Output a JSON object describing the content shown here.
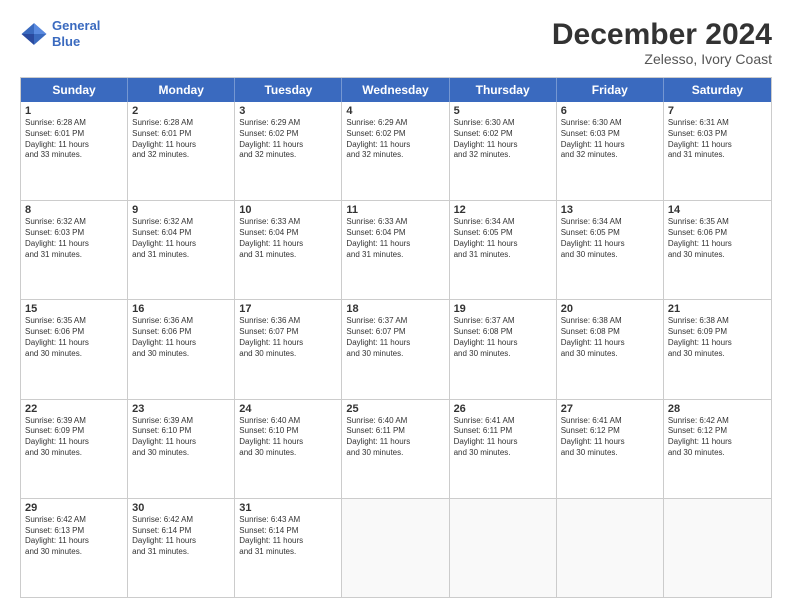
{
  "header": {
    "logo_line1": "General",
    "logo_line2": "Blue",
    "month_title": "December 2024",
    "location": "Zelesso, Ivory Coast"
  },
  "weekdays": [
    "Sunday",
    "Monday",
    "Tuesday",
    "Wednesday",
    "Thursday",
    "Friday",
    "Saturday"
  ],
  "rows": [
    [
      {
        "day": "1",
        "lines": [
          "Sunrise: 6:28 AM",
          "Sunset: 6:01 PM",
          "Daylight: 11 hours",
          "and 33 minutes."
        ]
      },
      {
        "day": "2",
        "lines": [
          "Sunrise: 6:28 AM",
          "Sunset: 6:01 PM",
          "Daylight: 11 hours",
          "and 32 minutes."
        ]
      },
      {
        "day": "3",
        "lines": [
          "Sunrise: 6:29 AM",
          "Sunset: 6:02 PM",
          "Daylight: 11 hours",
          "and 32 minutes."
        ]
      },
      {
        "day": "4",
        "lines": [
          "Sunrise: 6:29 AM",
          "Sunset: 6:02 PM",
          "Daylight: 11 hours",
          "and 32 minutes."
        ]
      },
      {
        "day": "5",
        "lines": [
          "Sunrise: 6:30 AM",
          "Sunset: 6:02 PM",
          "Daylight: 11 hours",
          "and 32 minutes."
        ]
      },
      {
        "day": "6",
        "lines": [
          "Sunrise: 6:30 AM",
          "Sunset: 6:03 PM",
          "Daylight: 11 hours",
          "and 32 minutes."
        ]
      },
      {
        "day": "7",
        "lines": [
          "Sunrise: 6:31 AM",
          "Sunset: 6:03 PM",
          "Daylight: 11 hours",
          "and 31 minutes."
        ]
      }
    ],
    [
      {
        "day": "8",
        "lines": [
          "Sunrise: 6:32 AM",
          "Sunset: 6:03 PM",
          "Daylight: 11 hours",
          "and 31 minutes."
        ]
      },
      {
        "day": "9",
        "lines": [
          "Sunrise: 6:32 AM",
          "Sunset: 6:04 PM",
          "Daylight: 11 hours",
          "and 31 minutes."
        ]
      },
      {
        "day": "10",
        "lines": [
          "Sunrise: 6:33 AM",
          "Sunset: 6:04 PM",
          "Daylight: 11 hours",
          "and 31 minutes."
        ]
      },
      {
        "day": "11",
        "lines": [
          "Sunrise: 6:33 AM",
          "Sunset: 6:04 PM",
          "Daylight: 11 hours",
          "and 31 minutes."
        ]
      },
      {
        "day": "12",
        "lines": [
          "Sunrise: 6:34 AM",
          "Sunset: 6:05 PM",
          "Daylight: 11 hours",
          "and 31 minutes."
        ]
      },
      {
        "day": "13",
        "lines": [
          "Sunrise: 6:34 AM",
          "Sunset: 6:05 PM",
          "Daylight: 11 hours",
          "and 30 minutes."
        ]
      },
      {
        "day": "14",
        "lines": [
          "Sunrise: 6:35 AM",
          "Sunset: 6:06 PM",
          "Daylight: 11 hours",
          "and 30 minutes."
        ]
      }
    ],
    [
      {
        "day": "15",
        "lines": [
          "Sunrise: 6:35 AM",
          "Sunset: 6:06 PM",
          "Daylight: 11 hours",
          "and 30 minutes."
        ]
      },
      {
        "day": "16",
        "lines": [
          "Sunrise: 6:36 AM",
          "Sunset: 6:06 PM",
          "Daylight: 11 hours",
          "and 30 minutes."
        ]
      },
      {
        "day": "17",
        "lines": [
          "Sunrise: 6:36 AM",
          "Sunset: 6:07 PM",
          "Daylight: 11 hours",
          "and 30 minutes."
        ]
      },
      {
        "day": "18",
        "lines": [
          "Sunrise: 6:37 AM",
          "Sunset: 6:07 PM",
          "Daylight: 11 hours",
          "and 30 minutes."
        ]
      },
      {
        "day": "19",
        "lines": [
          "Sunrise: 6:37 AM",
          "Sunset: 6:08 PM",
          "Daylight: 11 hours",
          "and 30 minutes."
        ]
      },
      {
        "day": "20",
        "lines": [
          "Sunrise: 6:38 AM",
          "Sunset: 6:08 PM",
          "Daylight: 11 hours",
          "and 30 minutes."
        ]
      },
      {
        "day": "21",
        "lines": [
          "Sunrise: 6:38 AM",
          "Sunset: 6:09 PM",
          "Daylight: 11 hours",
          "and 30 minutes."
        ]
      }
    ],
    [
      {
        "day": "22",
        "lines": [
          "Sunrise: 6:39 AM",
          "Sunset: 6:09 PM",
          "Daylight: 11 hours",
          "and 30 minutes."
        ]
      },
      {
        "day": "23",
        "lines": [
          "Sunrise: 6:39 AM",
          "Sunset: 6:10 PM",
          "Daylight: 11 hours",
          "and 30 minutes."
        ]
      },
      {
        "day": "24",
        "lines": [
          "Sunrise: 6:40 AM",
          "Sunset: 6:10 PM",
          "Daylight: 11 hours",
          "and 30 minutes."
        ]
      },
      {
        "day": "25",
        "lines": [
          "Sunrise: 6:40 AM",
          "Sunset: 6:11 PM",
          "Daylight: 11 hours",
          "and 30 minutes."
        ]
      },
      {
        "day": "26",
        "lines": [
          "Sunrise: 6:41 AM",
          "Sunset: 6:11 PM",
          "Daylight: 11 hours",
          "and 30 minutes."
        ]
      },
      {
        "day": "27",
        "lines": [
          "Sunrise: 6:41 AM",
          "Sunset: 6:12 PM",
          "Daylight: 11 hours",
          "and 30 minutes."
        ]
      },
      {
        "day": "28",
        "lines": [
          "Sunrise: 6:42 AM",
          "Sunset: 6:12 PM",
          "Daylight: 11 hours",
          "and 30 minutes."
        ]
      }
    ],
    [
      {
        "day": "29",
        "lines": [
          "Sunrise: 6:42 AM",
          "Sunset: 6:13 PM",
          "Daylight: 11 hours",
          "and 30 minutes."
        ]
      },
      {
        "day": "30",
        "lines": [
          "Sunrise: 6:42 AM",
          "Sunset: 6:14 PM",
          "Daylight: 11 hours",
          "and 31 minutes."
        ]
      },
      {
        "day": "31",
        "lines": [
          "Sunrise: 6:43 AM",
          "Sunset: 6:14 PM",
          "Daylight: 11 hours",
          "and 31 minutes."
        ]
      },
      {
        "day": "",
        "lines": []
      },
      {
        "day": "",
        "lines": []
      },
      {
        "day": "",
        "lines": []
      },
      {
        "day": "",
        "lines": []
      }
    ]
  ]
}
